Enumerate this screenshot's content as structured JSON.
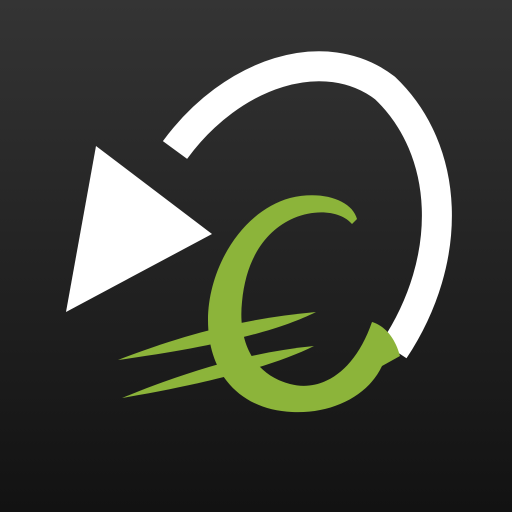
{
  "icon": {
    "symbol": "euro-refund-icon",
    "colors": {
      "background_top": "#343434",
      "background_bottom": "#121212",
      "arrow": "#ffffff",
      "euro": "#8cb43a"
    }
  }
}
